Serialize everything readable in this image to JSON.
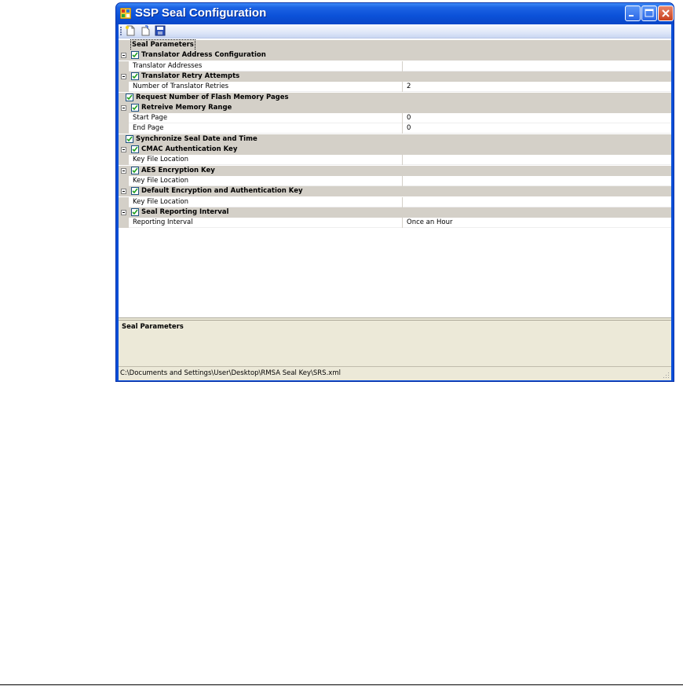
{
  "window": {
    "title": "SSP Seal Configuration",
    "controls": [
      "minimize-icon",
      "maximize-icon",
      "close-icon"
    ]
  },
  "toolbar": {
    "buttons": [
      "new-file-icon",
      "open-file-icon",
      "save-icon"
    ]
  },
  "grid": {
    "root_label": "Seal Parameters",
    "sections": [
      {
        "label": "Translator Address Configuration",
        "checked": true,
        "properties": [
          {
            "name": "Translator Addresses",
            "value": ""
          }
        ]
      },
      {
        "label": "Translator Retry Attempts",
        "checked": true,
        "properties": [
          {
            "name": "Number of Translator Retries",
            "value": "2"
          }
        ]
      },
      {
        "label": "Request Number of Flash Memory Pages",
        "checked": true,
        "properties": []
      },
      {
        "label": "Retreive Memory Range",
        "checked": true,
        "properties": [
          {
            "name": "Start Page",
            "value": "0"
          },
          {
            "name": "End Page",
            "value": "0"
          }
        ]
      },
      {
        "label": "Synchronize Seal Date and Time",
        "checked": true,
        "properties": []
      },
      {
        "label": "CMAC Authentication Key",
        "checked": true,
        "properties": [
          {
            "name": "Key File Location",
            "value": ""
          }
        ]
      },
      {
        "label": "AES Encryption Key",
        "checked": true,
        "properties": [
          {
            "name": "Key File Location",
            "value": ""
          }
        ]
      },
      {
        "label": "Default Encryption and Authentication Key",
        "checked": true,
        "properties": [
          {
            "name": "Key File Location",
            "value": ""
          }
        ]
      },
      {
        "label": "Seal Reporting Interval",
        "checked": true,
        "properties": [
          {
            "name": "Reporting Interval",
            "value": "Once an Hour"
          }
        ]
      }
    ]
  },
  "description": {
    "title": "Seal Parameters"
  },
  "status": {
    "path": "C:\\Documents and Settings\\User\\Desktop\\RMSA Seal Key\\SRS.xml"
  },
  "colors": {
    "title_bar": "#0a4fd8",
    "category_row": "#d4d0c8",
    "window_face": "#ece9d8",
    "checkbox_check": "#21a121"
  }
}
